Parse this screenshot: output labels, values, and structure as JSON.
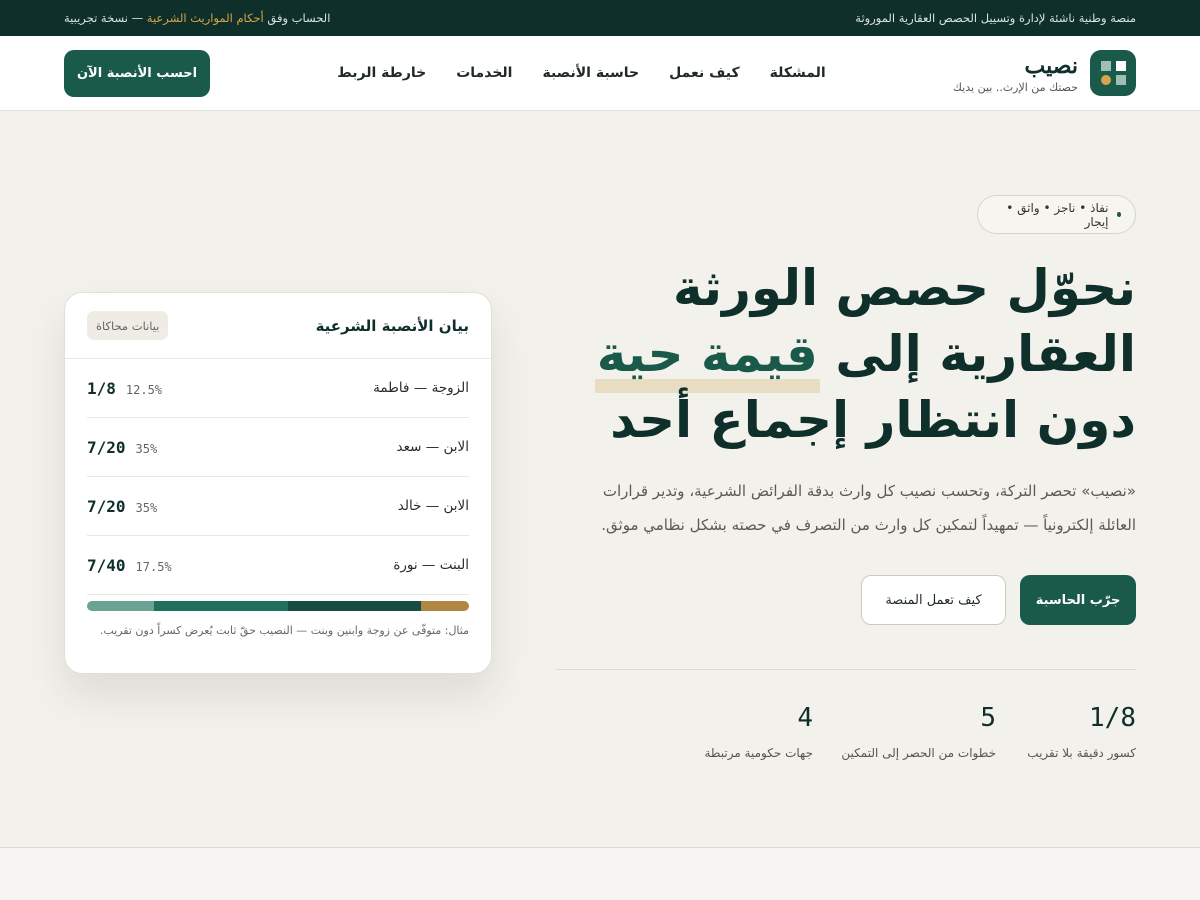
{
  "topbar": {
    "right_text": "منصة وطنية ناشئة لإدارة وتسييل الحصص العقارية الموروثة",
    "left_prefix": "الحساب وفق",
    "left_highlight": "أحكام المواريث الشرعية",
    "left_suffix": "— نسخة تجريبية"
  },
  "header": {
    "brand_name": "نصيب",
    "brand_tagline": "حصتك من الإرث.. بين يديك",
    "nav": [
      "المشكلة",
      "كيف نعمل",
      "حاسبة الأنصبة",
      "الخدمات",
      "خارطة الربط"
    ],
    "cta_label": "احسب الأنصبة الآن"
  },
  "hero": {
    "chip": "نفاذ • ناجز • واثق • إيجار",
    "headline_line1": "نحوّل حصص الورثة",
    "headline_line2_start": "العقارية إلى",
    "headline_highlight": "قيمة حية",
    "headline_line3": "دون انتظار إجماع أحد",
    "lede": "«نصيب» تحصر التركة، وتحسب نصيب كل وارث بدقة الفرائض الشرعية، وتدير قرارات العائلة إلكترونياً — تمهيداً لتمكين كل وارث من التصرف في حصته بشكل نظامي موثق.",
    "primary_button": "جرّب الحاسبة",
    "secondary_button": "كيف تعمل المنصة",
    "stats": [
      {
        "value": "1/8",
        "label": "كسور دقيقة بلا تقريب"
      },
      {
        "value": "5",
        "label": "خطوات من الحصر إلى التمكين"
      },
      {
        "value": "4",
        "label": "جهات حكومية مرتبطة"
      }
    ]
  },
  "card": {
    "title": "بيان الأنصبة الشرعية",
    "badge": "بيانات محاكاة",
    "rows": [
      {
        "name": "الزوجة — فاطمة",
        "fraction": "1/8",
        "percent": "12.5%"
      },
      {
        "name": "الابن — سعد",
        "fraction": "7/20",
        "percent": "35%"
      },
      {
        "name": "الابن — خالد",
        "fraction": "7/20",
        "percent": "35%"
      },
      {
        "name": "البنت — نورة",
        "fraction": "7/40",
        "percent": "17.5%"
      }
    ],
    "share_fractions": [
      0.175,
      0.35,
      0.35,
      0.125
    ],
    "share_colors": [
      "#6aa394",
      "#21705e",
      "#174d43",
      "#b08740"
    ],
    "note": "مثال: متوفّى عن زوجة وابنين وبنت — النصيب حقّ ثابت يُعرض كسراً دون تقريب."
  },
  "colors": {
    "accent": "#1a5a4b",
    "dark": "#0f2f2a",
    "gold": "#d6a548"
  }
}
